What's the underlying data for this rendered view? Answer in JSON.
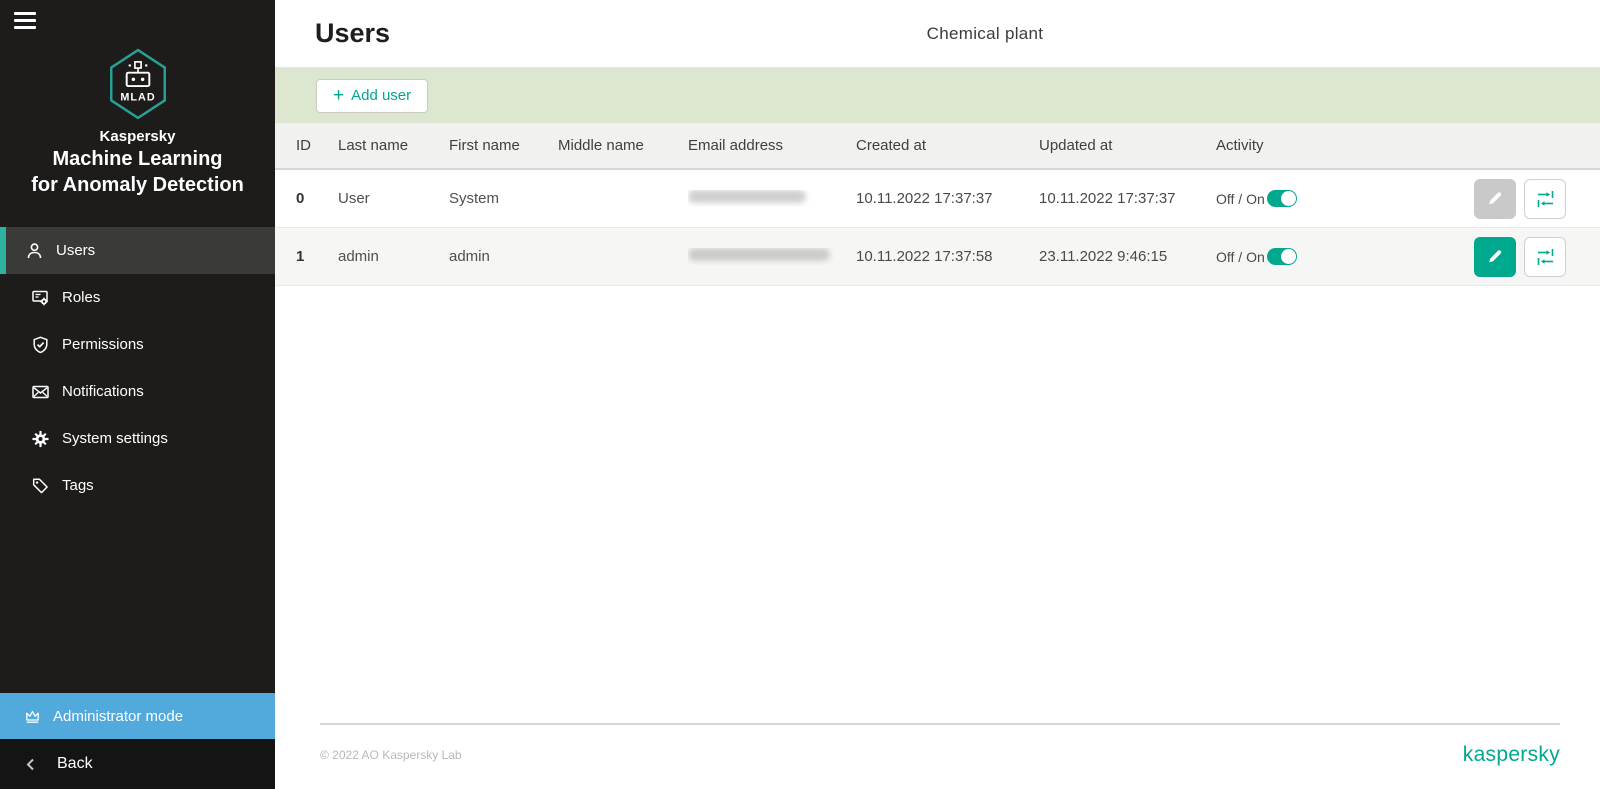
{
  "sidebar": {
    "brand": {
      "logo_text": "MLAD",
      "company": "Kaspersky",
      "product_line1": "Machine Learning",
      "product_line2": "for Anomaly Detection"
    },
    "items": [
      {
        "label": "Users",
        "icon": "user-icon",
        "active": true
      },
      {
        "label": "Roles",
        "icon": "roles-icon",
        "active": false
      },
      {
        "label": "Permissions",
        "icon": "shield-icon",
        "active": false
      },
      {
        "label": "Notifications",
        "icon": "envelope-icon",
        "active": false
      },
      {
        "label": "System settings",
        "icon": "gear-icon",
        "active": false
      },
      {
        "label": "Tags",
        "icon": "tag-icon",
        "active": false
      }
    ],
    "admin_mode": {
      "label": "Administrator mode",
      "icon": "crown-icon"
    },
    "back": {
      "label": "Back",
      "icon": "chevron-left-icon"
    }
  },
  "header": {
    "title": "Users",
    "center_title": "Chemical plant"
  },
  "toolbar": {
    "add_user_plus": "+",
    "add_user_label": "Add user"
  },
  "table": {
    "columns": [
      "ID",
      "Last name",
      "First name",
      "Middle name",
      "Email address",
      "Created at",
      "Updated at",
      "Activity"
    ],
    "rows": [
      {
        "id": "0",
        "last_name": "User",
        "first_name": "System",
        "middle_name": "",
        "email_redacted": true,
        "created_at": "10.11.2022 17:37:37",
        "updated_at": "10.11.2022 17:37:37",
        "activity_label": "Off / On",
        "activity_on": true,
        "edit_enabled": false
      },
      {
        "id": "1",
        "last_name": "admin",
        "first_name": "admin",
        "middle_name": "",
        "email_redacted": true,
        "created_at": "10.11.2022 17:37:58",
        "updated_at": "23.11.2022 9:46:15",
        "activity_label": "Off / On",
        "activity_on": true,
        "edit_enabled": true
      }
    ]
  },
  "footer": {
    "copyright": "© 2022 AO Kaspersky Lab",
    "brand": "kaspersky"
  },
  "colors": {
    "accent_teal": "#00a88e",
    "admin_blue": "#52a9dc",
    "toolbar_green": "#dde7cf",
    "sidebar_bg": "#1d1c1a",
    "active_item_bg": "#3a3a38"
  }
}
